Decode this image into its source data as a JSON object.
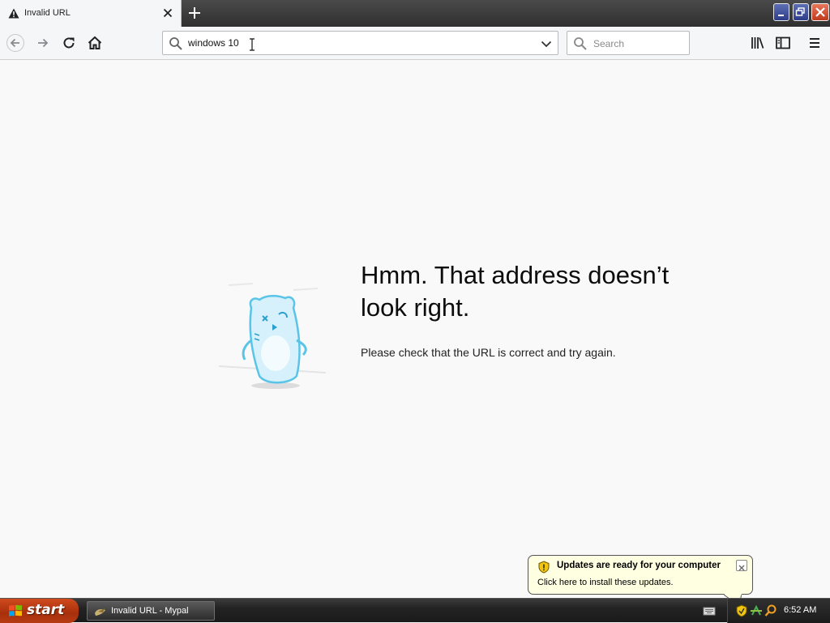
{
  "browser": {
    "tab_title": "Invalid URL",
    "url_value": "windows 10",
    "search_placeholder": "Search"
  },
  "error_page": {
    "title": "Hmm. That address doesn’t look right.",
    "description": "Please check that the URL is correct and try again."
  },
  "notification": {
    "title": "Updates are ready for your computer",
    "text": "Click here to install these updates."
  },
  "taskbar": {
    "start_label": "start",
    "task_item_label": "Invalid URL - Mypal",
    "clock": "6:52 AM"
  },
  "icons": {
    "tab_warning": "warning-icon",
    "back": "back-arrow-icon",
    "forward": "forward-arrow-icon",
    "reload": "reload-icon",
    "home": "home-icon",
    "library": "library-icon",
    "sidebar": "sidebar-icon",
    "menu": "hamburger-menu-icon"
  },
  "colors": {
    "page_background": "#f9f9fa",
    "balloon_background": "#ffffe1",
    "start_button": "#c23d12",
    "illustration_blue": "#7fd3ee"
  }
}
